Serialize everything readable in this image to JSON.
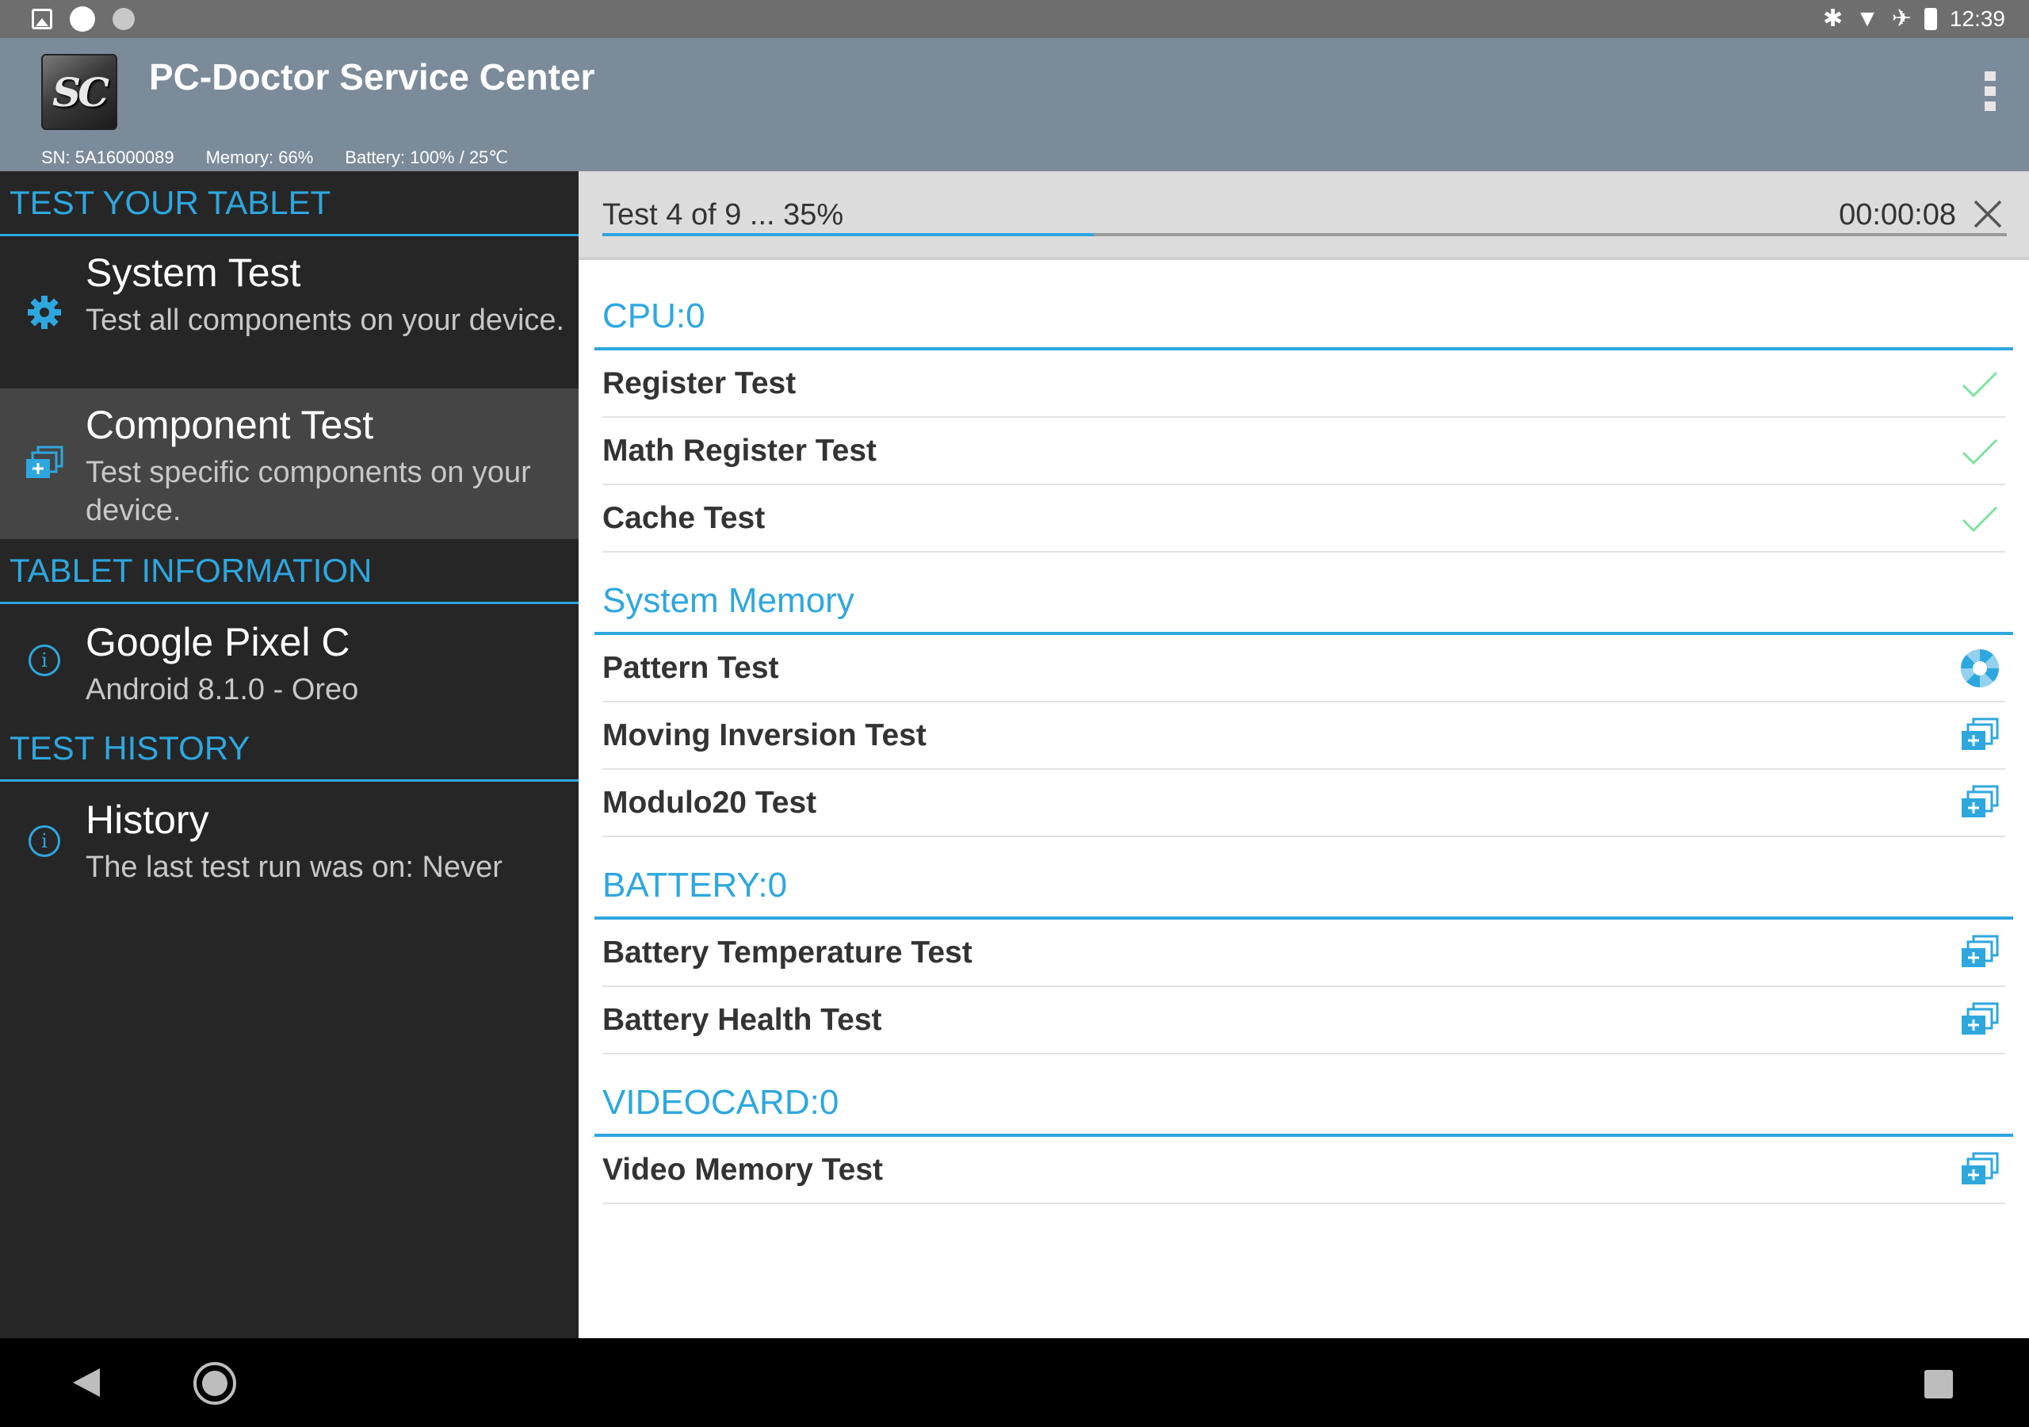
{
  "status_bar": {
    "time": "12:39"
  },
  "app": {
    "title": "PC-Doctor Service Center",
    "logo_text": "SC",
    "serial": "SN: 5A16000089",
    "memory": "Memory: 66%",
    "battery": "Battery: 100% / 25℃"
  },
  "sidebar": {
    "sections": {
      "test_tablet": "TEST YOUR TABLET",
      "tablet_info": "TABLET INFORMATION",
      "test_history": "TEST HISTORY"
    },
    "system_test": {
      "title": "System Test",
      "subtitle": "Test all components on your device."
    },
    "component_test": {
      "title": "Component Test",
      "subtitle": "Test specific components on your device."
    },
    "device": {
      "title": "Google Pixel C",
      "subtitle": "Android 8.1.0 - Oreo"
    },
    "history": {
      "title": "History",
      "subtitle": "The last test run was on: Never"
    }
  },
  "progress": {
    "label": "Test 4 of 9 ... 35%",
    "percent": 35,
    "elapsed": "00:00:08"
  },
  "groups": [
    {
      "name": "CPU:0",
      "tests": [
        {
          "name": "Register Test",
          "status": "passed"
        },
        {
          "name": "Math Register Test",
          "status": "passed"
        },
        {
          "name": "Cache Test",
          "status": "passed"
        }
      ]
    },
    {
      "name": "System Memory",
      "tests": [
        {
          "name": "Pattern Test",
          "status": "running"
        },
        {
          "name": "Moving Inversion Test",
          "status": "queued"
        },
        {
          "name": "Modulo20 Test",
          "status": "queued"
        }
      ]
    },
    {
      "name": "BATTERY:0",
      "tests": [
        {
          "name": "Battery Temperature Test",
          "status": "queued"
        },
        {
          "name": "Battery Health Test",
          "status": "queued"
        }
      ]
    },
    {
      "name": "VIDEOCARD:0",
      "tests": [
        {
          "name": "Video Memory Test",
          "status": "queued"
        }
      ]
    }
  ],
  "colors": {
    "accent": "#2ea7df",
    "app_bar": "#7c8b9a",
    "sidebar_bg": "#262626",
    "passed": "#7de3a0"
  },
  "icons": {
    "passed": "checkmark-icon",
    "running": "spinner-icon",
    "queued": "queued-stack-icon"
  }
}
